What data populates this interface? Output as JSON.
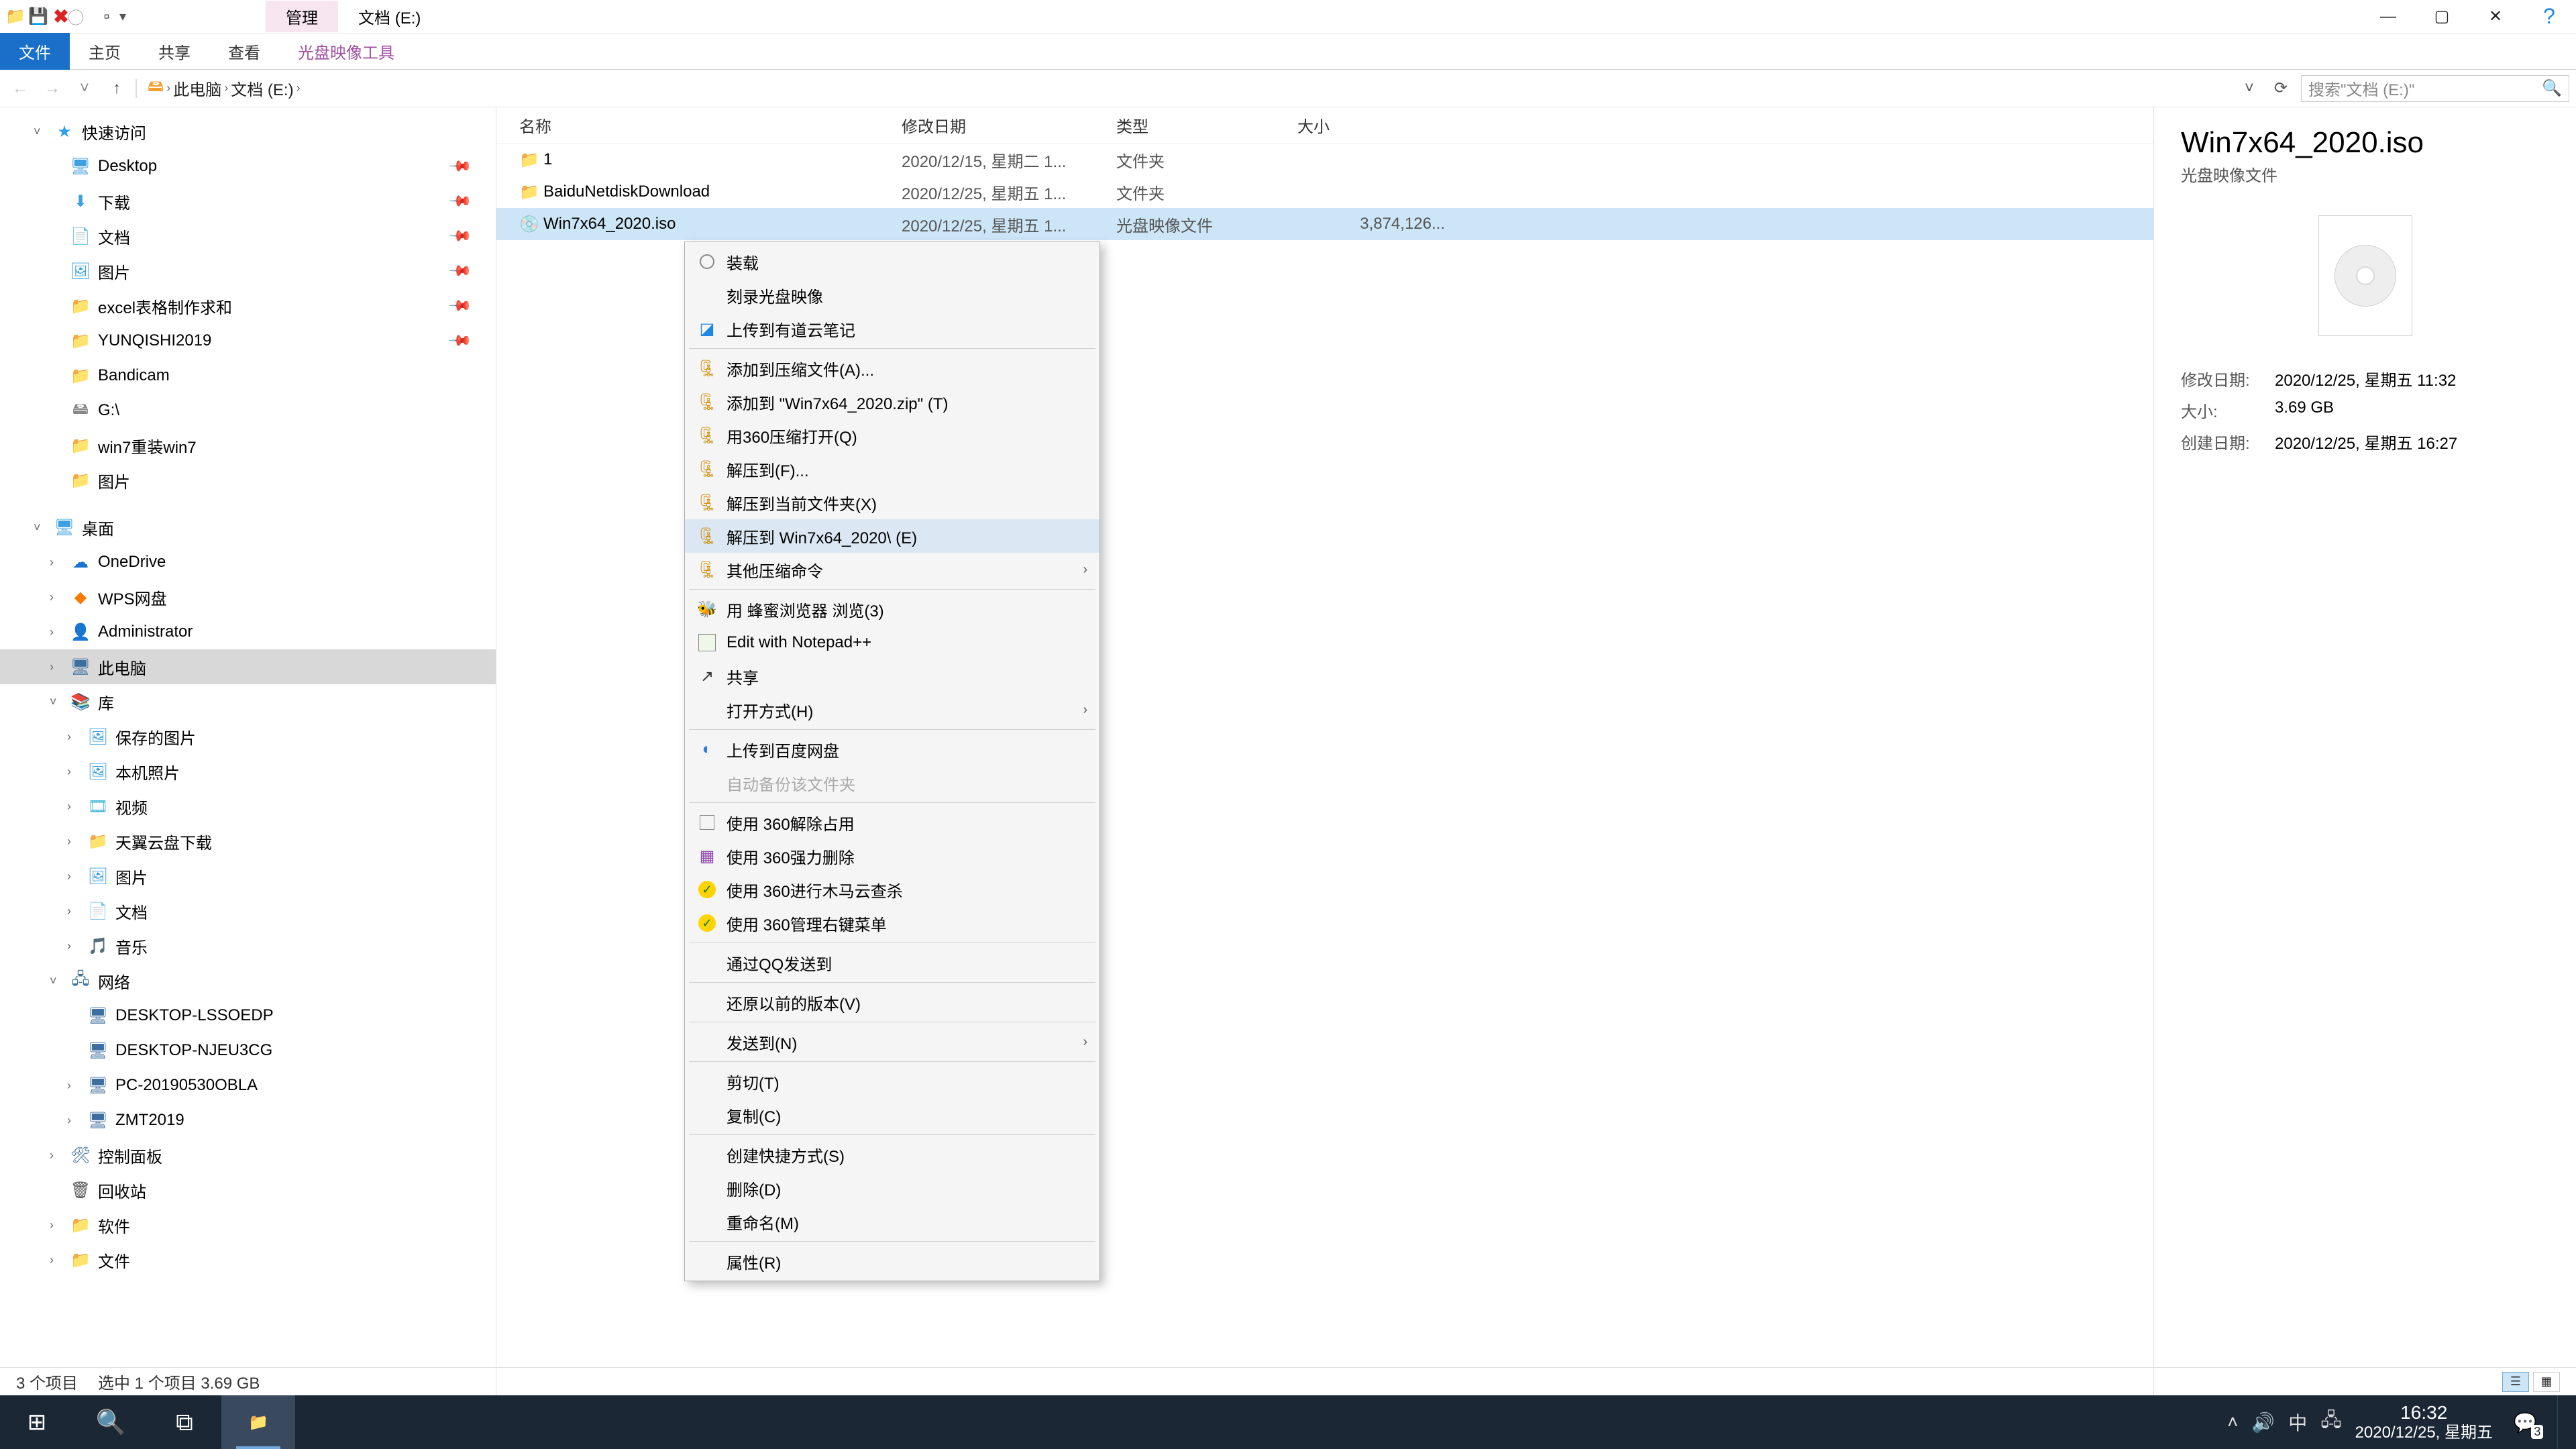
{
  "titlebar": {
    "tab_mgmt": "管理",
    "tab_drive": "文档 (E:)"
  },
  "ribbon": {
    "file": "文件",
    "home": "主页",
    "share": "共享",
    "view": "查看",
    "tools": "光盘映像工具"
  },
  "addr": {
    "root": "此电脑",
    "drive": "文档 (E:)",
    "search_placeholder": "搜索\"文档 (E:)\""
  },
  "tree": {
    "quick": "快速访问",
    "desktop": "Desktop",
    "downloads": "下载",
    "documents": "文档",
    "pictures": "图片",
    "excel": "excel表格制作求和",
    "yunqishi": "YUNQISHI2019",
    "bandicam": "Bandicam",
    "gdrive": "G:\\",
    "win7": "win7重装win7",
    "picsg": "图片",
    "desk_cn": "桌面",
    "onedrive": "OneDrive",
    "wps": "WPS网盘",
    "admin": "Administrator",
    "thispc": "此电脑",
    "libraries": "库",
    "saved_pics": "保存的图片",
    "local_photos": "本机照片",
    "videos": "视频",
    "tianyi": "天翼云盘下载",
    "lib_pics": "图片",
    "lib_docs": "文档",
    "lib_music": "音乐",
    "network": "网络",
    "pc1": "DESKTOP-LSSOEDP",
    "pc2": "DESKTOP-NJEU3CG",
    "pc3": "PC-20190530OBLA",
    "pc4": "ZMT2019",
    "cp": "控制面板",
    "recycle": "回收站",
    "software": "软件",
    "files_cn": "文件"
  },
  "cols": {
    "name": "名称",
    "date": "修改日期",
    "type": "类型",
    "size": "大小"
  },
  "rows": [
    {
      "name": "1",
      "date": "2020/12/15, 星期二 1...",
      "type": "文件夹",
      "size": ""
    },
    {
      "name": "BaiduNetdiskDownload",
      "date": "2020/12/25, 星期五 1...",
      "type": "文件夹",
      "size": ""
    },
    {
      "name": "Win7x64_2020.iso",
      "date": "2020/12/25, 星期五 1...",
      "type": "光盘映像文件",
      "size": "3,874,126..."
    }
  ],
  "ctx": {
    "mount": "装载",
    "burn": "刻录光盘映像",
    "upload_youdao": "上传到有道云笔记",
    "add_archive": "添加到压缩文件(A)...",
    "add_zip": "添加到 \"Win7x64_2020.zip\" (T)",
    "open_360zip": "用360压缩打开(Q)",
    "extract_to": "解压到(F)...",
    "extract_here": "解压到当前文件夹(X)",
    "extract_named": "解压到 Win7x64_2020\\ (E)",
    "other_zip": "其他压缩命令",
    "bee_browser": "用 蜂蜜浏览器 浏览(3)",
    "notepad": "Edit with Notepad++",
    "share": "共享",
    "open_with": "打开方式(H)",
    "upload_baidu": "上传到百度网盘",
    "auto_backup": "自动备份该文件夹",
    "use_360_release": "使用 360解除占用",
    "use_360_force": "使用 360强力删除",
    "use_360_trojan": "使用 360进行木马云查杀",
    "use_360_menu": "使用 360管理右键菜单",
    "qq_send": "通过QQ发送到",
    "restore": "还原以前的版本(V)",
    "send_to": "发送到(N)",
    "cut": "剪切(T)",
    "copy": "复制(C)",
    "shortcut": "创建快捷方式(S)",
    "delete": "删除(D)",
    "rename": "重命名(M)",
    "properties": "属性(R)"
  },
  "preview": {
    "title": "Win7x64_2020.iso",
    "type": "光盘映像文件",
    "k_modified": "修改日期:",
    "v_modified": "2020/12/25, 星期五 11:32",
    "k_size": "大小:",
    "v_size": "3.69 GB",
    "k_created": "创建日期:",
    "v_created": "2020/12/25, 星期五 16:27"
  },
  "status": {
    "items": "3 个项目",
    "selected": "选中 1 个项目  3.69 GB"
  },
  "taskbar": {
    "ime": "中",
    "time": "16:32",
    "date": "2020/12/25, 星期五"
  }
}
